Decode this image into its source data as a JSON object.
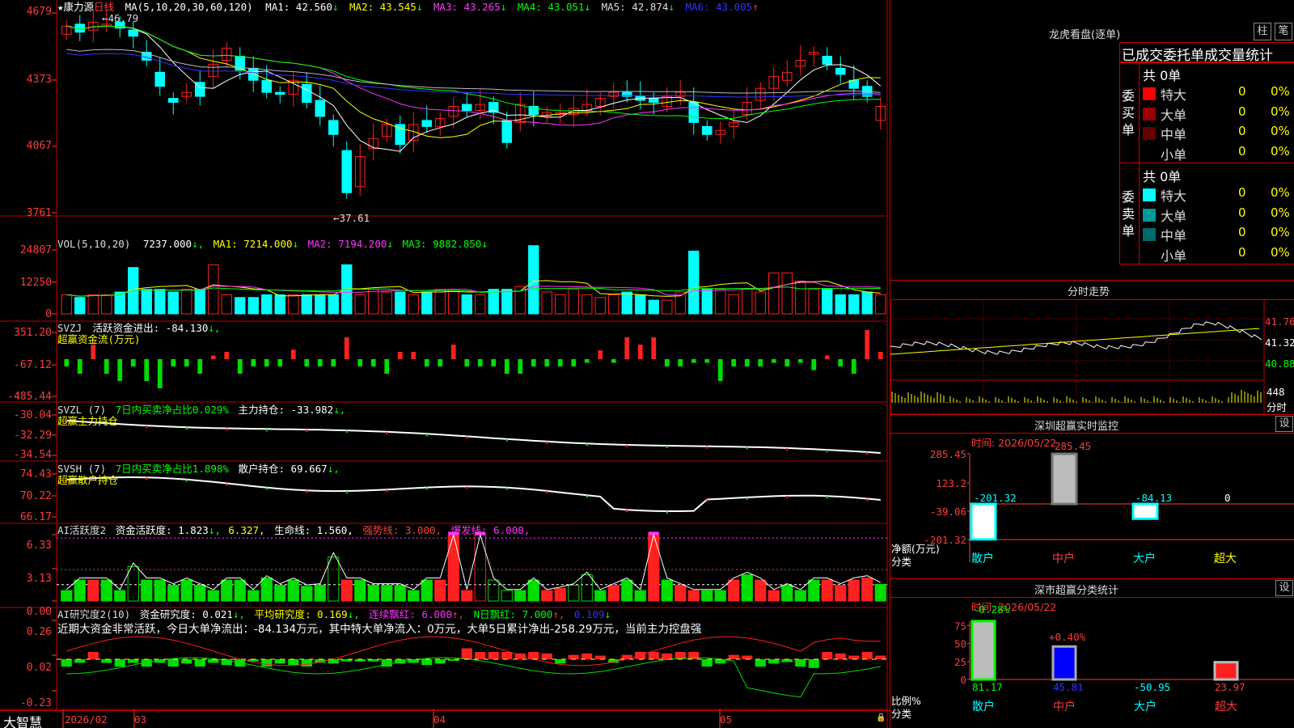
{
  "stock": {
    "star": "★",
    "name": "康力源",
    "period": "日线"
  },
  "main": {
    "ma_title": "MA(5,10,20,30,60,120)",
    "ma": [
      {
        "label": "MA1: 42.560",
        "arrow": "↓",
        "color": "#ffffff"
      },
      {
        "label": "MA2: 43.545",
        "arrow": "↓",
        "color": "#ffff00"
      },
      {
        "label": "MA3: 43.265",
        "arrow": "↓",
        "color": "#ff33ff"
      },
      {
        "label": "MA4: 43.051",
        "arrow": "↓",
        "color": "#00ff00"
      },
      {
        "label": "MA5: 42.874",
        "arrow": "↓",
        "color": "#dddddd"
      },
      {
        "label": "MA6: 43.005",
        "arrow": "↑",
        "color": "#3333ff"
      }
    ],
    "y_ticks": [
      "4679",
      "4373",
      "4067",
      "3761"
    ],
    "high_label": "46.79",
    "low_label": "37.61"
  },
  "vol": {
    "title": "VOL(5,10,20)",
    "value": "7237.000",
    "ma": [
      {
        "label": "MA1: 7214.000",
        "arrow": "↓",
        "color": "#ffff00"
      },
      {
        "label": "MA2: 7194.200",
        "arrow": "↓",
        "color": "#ff33ff"
      },
      {
        "label": "MA3: 9882.850",
        "arrow": "↓",
        "color": "#00ff00"
      }
    ],
    "y_ticks": [
      "24807",
      "12250",
      "0"
    ]
  },
  "svzj": {
    "title": "SVZJ",
    "line1": "活跃资金进出: -84.130",
    "line1_arrow": "↓,",
    "line2": "超赢资金流(万元)",
    "y_ticks": [
      "351.20",
      "-67.12",
      "-485.44"
    ]
  },
  "svzl": {
    "title": "SVZL (7)",
    "ratio": "7日内买卖净占比0.029%",
    "hold": "主力持仓: -33.982",
    "arrow": "↓,",
    "line2": "超赢主力持仓",
    "y_ticks": [
      "-30.04",
      "-32.29",
      "-34.54"
    ]
  },
  "svsh": {
    "title": "SVSH (7)",
    "ratio": "7日内买卖净占比1.898%",
    "hold": "散户持仓: 69.667",
    "arrow": "↓,",
    "line2": "超赢散户持仓",
    "y_ticks": [
      "74.43",
      "70.22",
      "66.17"
    ]
  },
  "ai_active": {
    "title": "AI活跃度2",
    "v1": "资金活跃度: 1.823",
    "v1_arrow": "↓,",
    "v2": "6.327,",
    "v3": "生命线: 1.560,",
    "v4": "强势线: 3.000,",
    "v5": "爆发线: 6.000,",
    "y_ticks": [
      "6.33",
      "3.13",
      "0.00"
    ]
  },
  "ai_research": {
    "title": "AI研究度2(10)",
    "v1": "资金研究度: 0.021",
    "v1_arrow": "↓,",
    "v2": "平均研究度: 0.169",
    "v2_arrow": "↓,",
    "v3": "连续飘红: 6.000",
    "v3_arrow": "↑,",
    "v4": "N日飘红: 7.000",
    "v4_arrow": "↑,",
    "v5": "0.109",
    "v5_arrow": "↓",
    "comment": "近期大资金非常活跃，今日大单净流出：-84.134万元，其中特大单净流入：0万元，大单5日累计净出-258.29万元，当前主力控盘强",
    "y_ticks": [
      "0.26",
      "0.02",
      "-0.23"
    ]
  },
  "date_axis": {
    "brand": "大智慧",
    "labels": [
      "2026/02",
      "03",
      "04",
      "05"
    ]
  },
  "dragon": {
    "title": "龙虎看盘(逐单)",
    "btn_zhu": "柱",
    "btn_bi": "笔",
    "subtitle": "已成交委托单成交量统计",
    "buy_label": "委买单",
    "sell_label": "委卖单",
    "buy_total": "共 0单",
    "sell_total": "共 0单",
    "buy_rows": [
      {
        "name": "特大",
        "count": "0",
        "pct": "0%",
        "color": "#ff0000"
      },
      {
        "name": "大单",
        "count": "0",
        "pct": "0%",
        "color": "#990000"
      },
      {
        "name": "中单",
        "count": "0",
        "pct": "0%",
        "color": "#660000"
      },
      {
        "name": "小单",
        "count": "0",
        "pct": "0%",
        "color": "#000000"
      }
    ],
    "sell_rows": [
      {
        "name": "特大",
        "count": "0",
        "pct": "0%",
        "color": "#00ffff"
      },
      {
        "name": "大单",
        "count": "0",
        "pct": "0%",
        "color": "#009999"
      },
      {
        "name": "中单",
        "count": "0",
        "pct": "0%",
        "color": "#006b6b"
      },
      {
        "name": "小单",
        "count": "0",
        "pct": "0%",
        "color": "#000000"
      }
    ]
  },
  "intraday": {
    "title": "分时走势",
    "price_ticks": [
      "41.76",
      "41.32",
      "40.88"
    ],
    "vol_tick": "448",
    "vol_unit": "分时"
  },
  "sz_monitor": {
    "title": "深圳超赢实时监控",
    "settings": "设",
    "time": "时间: 2026/05/22",
    "y_ticks": [
      "285.45",
      "123.2",
      "-39.06",
      "-201.32"
    ],
    "bar_labels": [
      "-201.32",
      "285.45",
      "-84.13",
      "0"
    ],
    "net_label": "净额(万元)",
    "cat_label": "分类",
    "categories": [
      "散户",
      "中户",
      "大户",
      "超大"
    ],
    "values": [
      -201.32,
      285.45,
      -84.13,
      0
    ]
  },
  "sz_class": {
    "title": "深市超赢分类统计",
    "settings": "设",
    "time": "时间: 2026/05/22",
    "y_ticks": [
      "75",
      "50",
      "25",
      "0"
    ],
    "top_labels": [
      "-0.28%",
      "+0.40%"
    ],
    "ratio_label": "比例%",
    "cat_label": "分类",
    "values_text": [
      "81.17",
      "45.81",
      "-50.95",
      "23.97"
    ],
    "ratios": [
      81.17,
      45.81,
      0,
      23.97
    ],
    "categories": [
      "散户",
      "中户",
      "大户",
      "超大"
    ]
  },
  "colors": {
    "up": "#ff2020",
    "down": "#00ffff",
    "frame": "#c00000",
    "label": "#ff3b3b"
  }
}
